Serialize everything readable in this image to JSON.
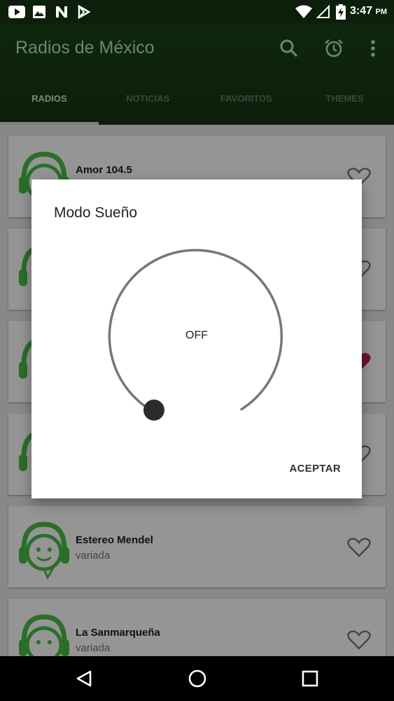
{
  "statusbar": {
    "time": "3:47",
    "ampm": "PM",
    "icons": [
      "youtube-icon",
      "image-icon",
      "n-icon",
      "play-store-icon",
      "wifi-icon",
      "signal-icon",
      "battery-charging-icon"
    ]
  },
  "appbar": {
    "title": "Radios de México",
    "icons": [
      "search-icon",
      "alarm-icon",
      "more-vert-icon"
    ]
  },
  "tabs": [
    {
      "label": "RADIOS",
      "active": true
    },
    {
      "label": "NOTICIAS",
      "active": false
    },
    {
      "label": "FAVORITOS",
      "active": false
    },
    {
      "label": "THEMES",
      "active": false
    }
  ],
  "stations": [
    {
      "name": "Amor 104.5",
      "genre": "",
      "favorite": false
    },
    {
      "name": "",
      "genre": "",
      "favorite": false
    },
    {
      "name": "",
      "genre": "",
      "favorite": true
    },
    {
      "name": "",
      "genre": "",
      "favorite": false
    },
    {
      "name": "Estereo Mendel",
      "genre": "variada",
      "favorite": false
    },
    {
      "name": "La Sanmarqueña",
      "genre": "variada",
      "favorite": false
    }
  ],
  "dialog": {
    "title": "Modo Sueño",
    "value": "OFF",
    "confirm_label": "ACEPTAR"
  },
  "colors": {
    "accent": "#2e9c2e",
    "favorite": "#c2185b"
  }
}
